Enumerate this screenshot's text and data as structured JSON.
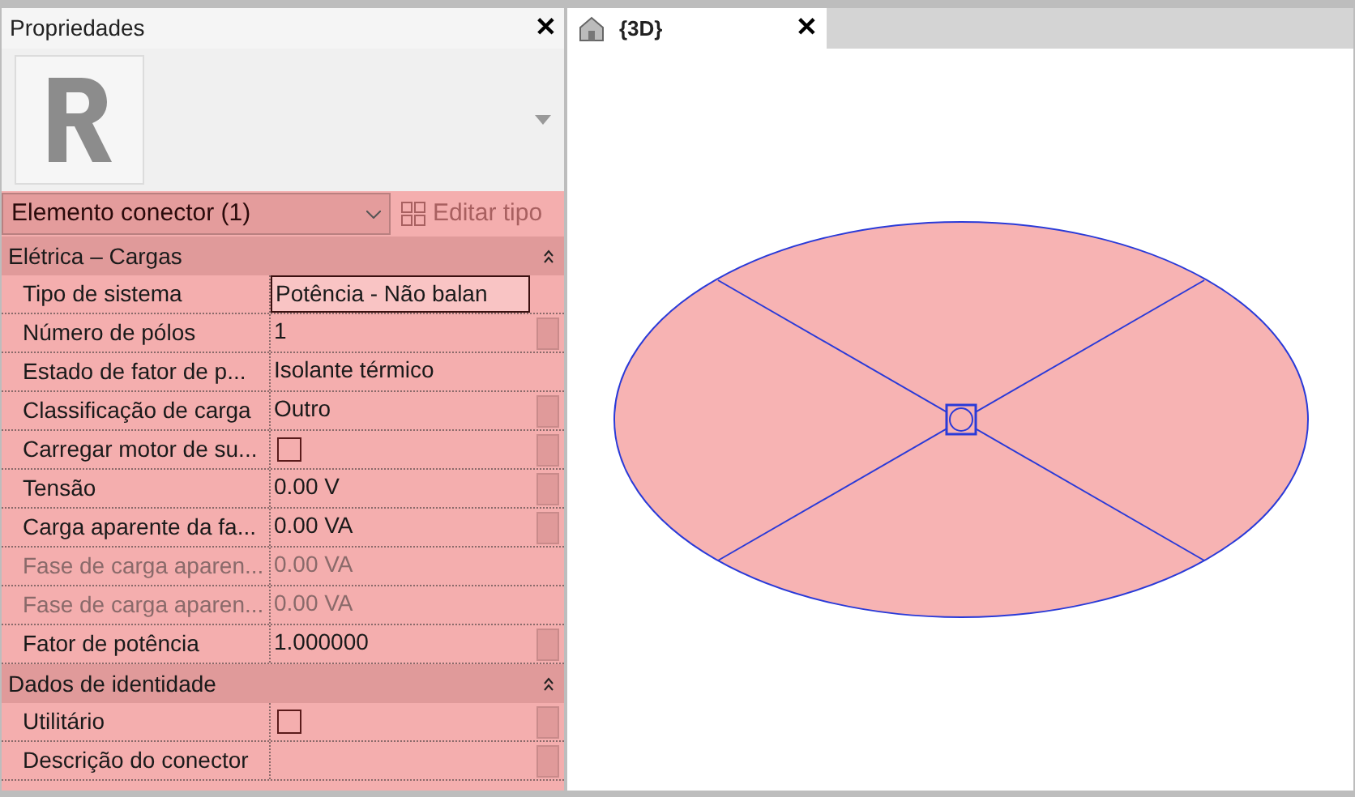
{
  "properties_panel": {
    "title": "Propriedades",
    "close": "✕",
    "type_selector": {
      "value": "Elemento conector (1)"
    },
    "edit_type_button": {
      "label": "Editar tipo",
      "disabled": true
    },
    "groups": [
      {
        "name": "Elétrica – Cargas",
        "expanded": true,
        "rows": [
          {
            "label": "Tipo de sistema",
            "kind": "text",
            "value": "Potência - Não balan",
            "editing": true,
            "disabled": false,
            "side_button": false
          },
          {
            "label": "Número de pólos",
            "kind": "text",
            "value": "1",
            "disabled": false,
            "side_button": true
          },
          {
            "label": "Estado de fator de p...",
            "kind": "text",
            "value": "Isolante térmico",
            "disabled": false,
            "side_button": false
          },
          {
            "label": "Classificação de carga",
            "kind": "text",
            "value": "Outro",
            "disabled": false,
            "side_button": true
          },
          {
            "label": "Carregar motor de su...",
            "kind": "checkbox",
            "checked": false,
            "disabled": false,
            "side_button": true
          },
          {
            "label": "Tensão",
            "kind": "text",
            "value": "0.00 V",
            "disabled": false,
            "side_button": true
          },
          {
            "label": "Carga aparente da fa...",
            "kind": "text",
            "value": "0.00 VA",
            "disabled": false,
            "side_button": true
          },
          {
            "label": "Fase de carga aparen...",
            "kind": "text",
            "value": "0.00 VA",
            "disabled": true,
            "side_button": false
          },
          {
            "label": "Fase de carga aparen...",
            "kind": "text",
            "value": "0.00 VA",
            "disabled": true,
            "side_button": false
          },
          {
            "label": "Fator de potência",
            "kind": "text",
            "value": "1.000000",
            "disabled": false,
            "side_button": true
          }
        ]
      },
      {
        "name": "Dados de identidade",
        "expanded": true,
        "rows": [
          {
            "label": "Utilitário",
            "kind": "checkbox",
            "checked": false,
            "disabled": false,
            "side_button": true
          },
          {
            "label": "Descrição do conector",
            "kind": "text",
            "disabled": false,
            "side_button": true
          }
        ]
      }
    ]
  },
  "view_tab": {
    "label": "{3D}",
    "close": "✕",
    "selected": true
  }
}
